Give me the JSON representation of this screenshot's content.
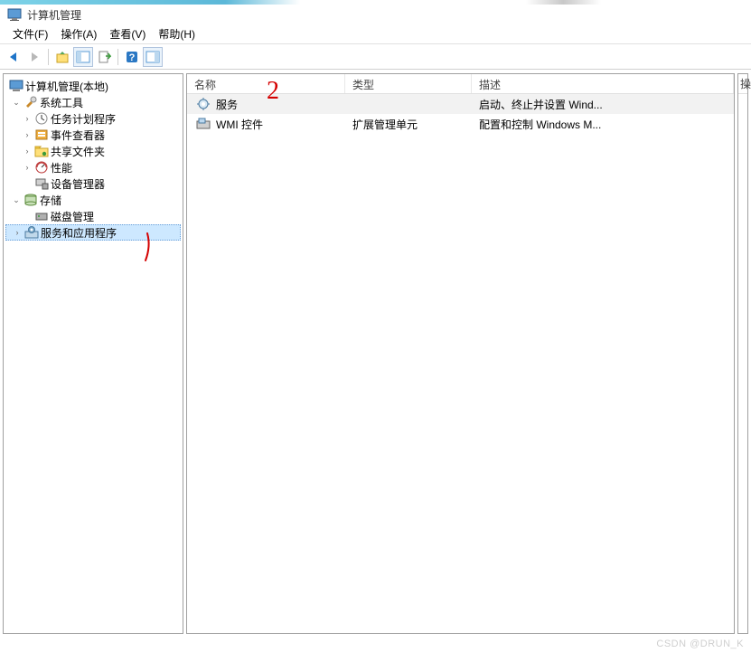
{
  "title": "计算机管理",
  "menus": {
    "file": "文件(F)",
    "action": "操作(A)",
    "view": "查看(V)",
    "help": "帮助(H)"
  },
  "tree": {
    "root": "计算机管理(本地)",
    "systools": "系统工具",
    "task_scheduler": "任务计划程序",
    "event_viewer": "事件查看器",
    "shared_folders": "共享文件夹",
    "performance": "性能",
    "device_manager": "设备管理器",
    "storage": "存储",
    "disk_mgmt": "磁盘管理",
    "services_apps": "服务和应用程序"
  },
  "columns": {
    "name": "名称",
    "type": "类型",
    "desc": "描述"
  },
  "rows": [
    {
      "name": "服务",
      "type": "",
      "desc": "启动、终止并设置 Wind..."
    },
    {
      "name": "WMI 控件",
      "type": "扩展管理单元",
      "desc": "配置和控制 Windows M..."
    }
  ],
  "actions_label": "操",
  "annotations": {
    "mark2": "2"
  },
  "watermark": "CSDN @DRUN_K"
}
